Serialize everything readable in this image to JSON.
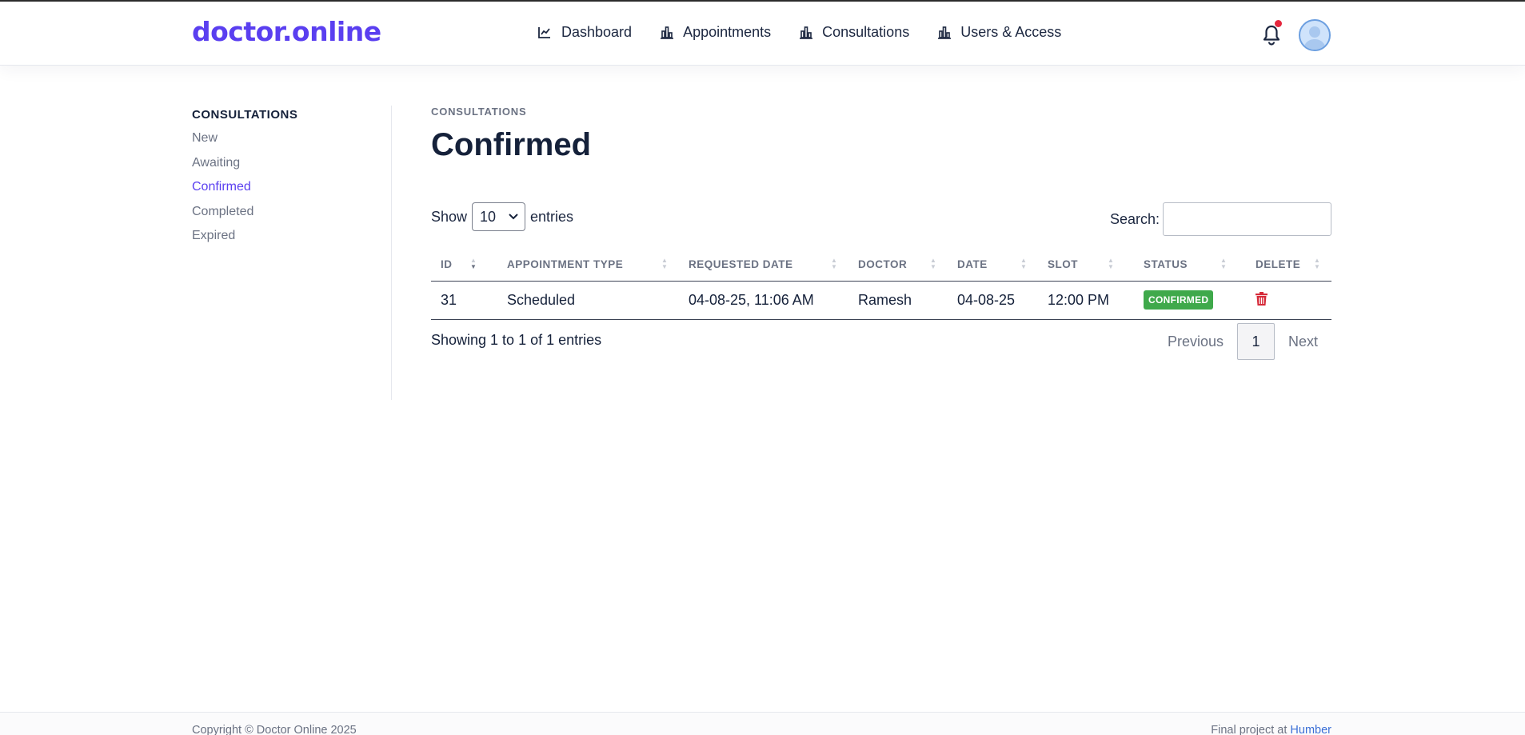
{
  "brand": "doctor.online",
  "nav": [
    {
      "label": "Dashboard",
      "icon": "chart-line-icon"
    },
    {
      "label": "Appointments",
      "icon": "bar-chart-icon"
    },
    {
      "label": "Consultations",
      "icon": "bar-chart-icon"
    },
    {
      "label": "Users & Access",
      "icon": "bar-chart-icon"
    }
  ],
  "colors": {
    "accent": "#5a3ff0",
    "status_confirmed": "#3fa94b",
    "danger": "#d62b3a",
    "notification": "#e5263d"
  },
  "sidebar": {
    "title": "CONSULTATIONS",
    "items": [
      "New",
      "Awaiting",
      "Confirmed",
      "Completed",
      "Expired"
    ],
    "active": "Confirmed"
  },
  "main": {
    "breadcrumb": "CONSULTATIONS",
    "title": "Confirmed",
    "show_label": "Show",
    "entries_value": "10",
    "entries_label": "entries",
    "search_label": "Search:"
  },
  "table": {
    "headers": [
      "ID",
      "APPOINTMENT TYPE",
      "REQUESTED DATE",
      "DOCTOR",
      "DATE",
      "SLOT",
      "STATUS",
      "DELETE"
    ],
    "rows": [
      {
        "id": "31",
        "type": "Scheduled",
        "requested": "04-08-25, 11:06 AM",
        "doctor": "Ramesh",
        "date": "04-08-25",
        "slot": "12:00 PM",
        "status": "CONFIRMED"
      }
    ]
  },
  "info_text": "Showing 1 to 1 of 1 entries",
  "pager": {
    "previous": "Previous",
    "page": "1",
    "next": "Next"
  },
  "footer": {
    "left": "Copyright © Doctor Online 2025",
    "right_prefix": "Final project at",
    "right_link": "Humber"
  }
}
